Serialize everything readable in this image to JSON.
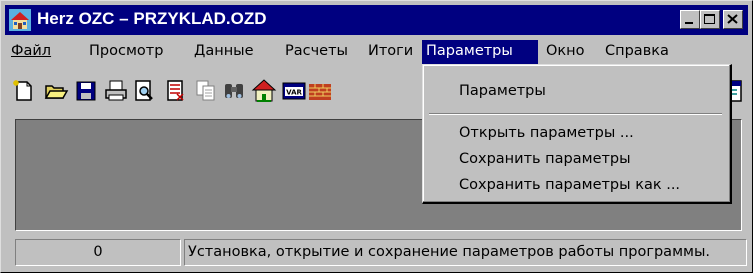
{
  "window": {
    "title": "Herz OZC – PRZYKLAD.OZD"
  },
  "menubar": {
    "items": [
      {
        "label": "Файл"
      },
      {
        "label": "Просмотр"
      },
      {
        "label": "Данные"
      },
      {
        "label": "Расчеты"
      },
      {
        "label": "Итоги"
      },
      {
        "label": "Параметры",
        "active": true
      },
      {
        "label": "Окно"
      },
      {
        "label": "Справка"
      }
    ]
  },
  "parameters_menu": {
    "items": [
      {
        "label": "Параметры"
      },
      {
        "label": "Открыть параметры ..."
      },
      {
        "label": "Сохранить параметры"
      },
      {
        "label": "Сохранить параметры как ..."
      }
    ]
  },
  "toolbar": {
    "icons": [
      "new-file-icon",
      "open-folder-icon",
      "save-disk-icon",
      "print-icon",
      "print-preview-icon",
      "calculator-icon",
      "copy-icon",
      "binoculars-icon",
      "house-icon",
      "variable-icon",
      "wall-icon",
      "window-icon"
    ]
  },
  "statusbar": {
    "count": "0",
    "message": "Установка, открытие и сохранение параметров работы программы."
  },
  "colors": {
    "titlebar": "#000080",
    "face": "#c0c0c0",
    "workspace": "#808080",
    "highlight": "#000080"
  }
}
